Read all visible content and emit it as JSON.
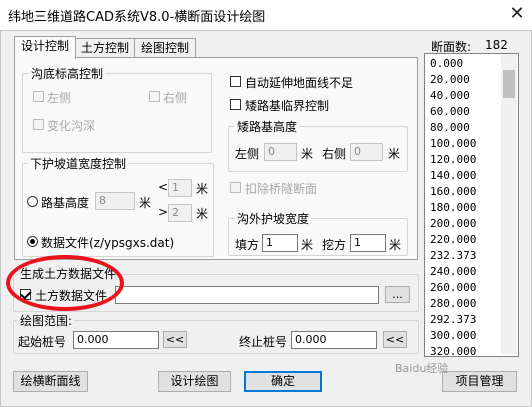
{
  "window": {
    "title": "纬地三维道路CAD系统V8.0-横断面设计绘图",
    "close_glyph": "✕"
  },
  "tabs": [
    {
      "label": "设计控制",
      "active": true
    },
    {
      "label": "土方控制",
      "active": false
    },
    {
      "label": "绘图控制",
      "active": false
    }
  ],
  "ditch_bottom": {
    "title": "沟底标高控制",
    "left_label": "左侧",
    "right_label": "右侧",
    "vary_label": "变化沟深"
  },
  "options": {
    "auto_extend_label": "自动延伸地面线不足",
    "shoulder_label": "矮路基临界控制"
  },
  "low_subgrade": {
    "title": "矮路基高度",
    "left_label": "左侧",
    "left_value": "0",
    "right_label": "右侧",
    "right_value": "0",
    "unit": "米"
  },
  "bridge_tunnel": {
    "label": "扣除桥隧断面"
  },
  "slope_width": {
    "title": "下护坡道宽度控制",
    "by_height_label": "路基高度",
    "height_value": "8",
    "unit": "米",
    "lt_symbol": "<",
    "gt_symbol": ">",
    "lt_value": "1",
    "gt_value": "2",
    "file_label": "数据文件(z/ypsgxs.dat)"
  },
  "ditch_outer": {
    "title": "沟外护坡宽度",
    "fill_label": "填方",
    "fill_value": "1",
    "cut_label": "挖方",
    "cut_value": "1",
    "unit": "米"
  },
  "earthwork_gen": {
    "title": "生成土方数据文件",
    "checkbox_label": "土方数据文件",
    "path_value": "",
    "browse_label": "..."
  },
  "draw_range": {
    "title": "绘图范围:",
    "start_label": "起始桩号",
    "start_value": "0.000",
    "end_label": "终止桩号",
    "end_value": "0.000",
    "pick_label": "<<"
  },
  "section_list": {
    "header_label": "断面数:",
    "count": "182",
    "items": [
      "0.000",
      "20.000",
      "40.000",
      "60.000",
      "80.000",
      "100.000",
      "120.000",
      "140.000",
      "160.000",
      "180.000",
      "200.000",
      "220.000",
      "232.373",
      "240.000",
      "260.000",
      "280.000",
      "292.373",
      "300.000",
      "320.000"
    ]
  },
  "buttons": {
    "draw_cross": "绘横断面线",
    "design_draw": "设计绘图",
    "ok": "确定",
    "project": "项目管理"
  },
  "watermark": "Baidu经验"
}
